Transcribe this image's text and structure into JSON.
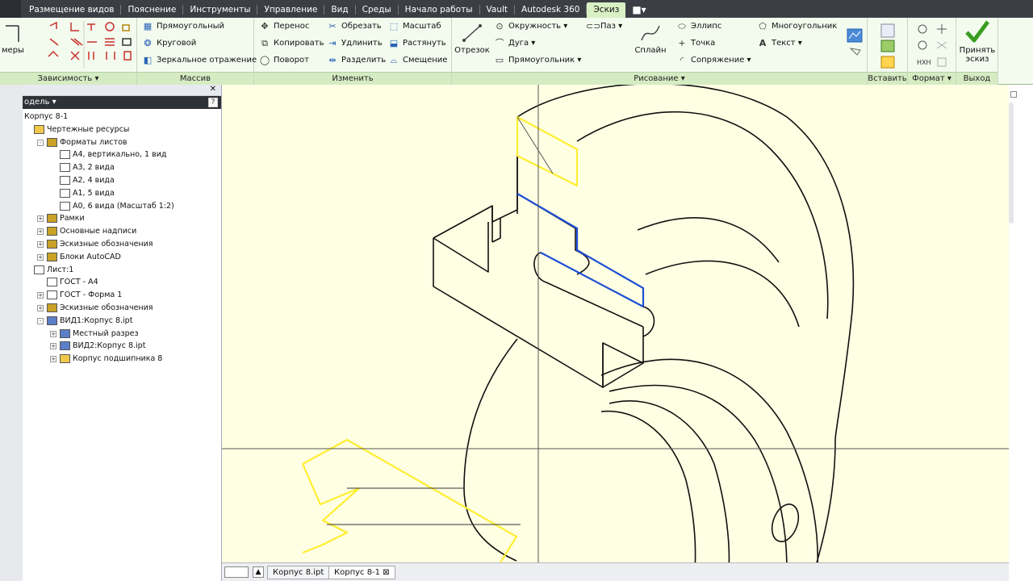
{
  "ribbon_tabs": [
    "Размещение видов",
    "Пояснение",
    "Инструменты",
    "Управление",
    "Вид",
    "Среды",
    "Начало работы",
    "Vault",
    "Autodesk 360",
    "Эскиз"
  ],
  "active_tab": "Эскиз",
  "tab_extra_icon": "video-icon",
  "ribbon": {
    "constraints": {
      "label": "Зависимость",
      "dims_label": "меры"
    },
    "pattern": {
      "label": "Массив",
      "rectangular": "Прямоугольный",
      "circular": "Круговой",
      "mirror": "Зеркальное отражение"
    },
    "modify": {
      "label": "Изменить",
      "move": "Перенос",
      "copy": "Копировать",
      "rotate": "Поворот",
      "trim": "Обрезать",
      "extend": "Удлинить",
      "split": "Разделить",
      "scale": "Масштаб",
      "stretch": "Растянуть",
      "offset": "Смещение"
    },
    "draw": {
      "label": "Рисование",
      "line": "Отрезок",
      "circle": "Окружность",
      "arc": "Дуга",
      "rectangle": "Прямоугольник",
      "slot": "Паз",
      "spline": "Сплайн",
      "ellipse": "Эллипс",
      "point": "Точка",
      "fillet": "Сопряжение",
      "polygon": "Многоугольник",
      "text": "Текст"
    },
    "insert": {
      "label": "Вставить"
    },
    "format": {
      "label": "Формат"
    },
    "exit": {
      "label": "Выход",
      "finish": "Принять эскиз"
    }
  },
  "browser": {
    "title": "одель",
    "help": "?",
    "tree": [
      {
        "label": "Корпус 8-1",
        "level": 0,
        "icon": "none",
        "expand": ""
      },
      {
        "label": "Чертежные ресурсы",
        "level": 0,
        "icon": "folder-icon",
        "expand": ""
      },
      {
        "label": "Форматы листов",
        "level": 1,
        "icon": "sheet-formats-icon",
        "expand": "-"
      },
      {
        "label": "А4, вертикально, 1 вид",
        "level": 2,
        "icon": "sheet-icon",
        "expand": ""
      },
      {
        "label": "А3, 2 вида",
        "level": 2,
        "icon": "sheet-icon",
        "expand": ""
      },
      {
        "label": "А2, 4 вида",
        "level": 2,
        "icon": "sheet-icon",
        "expand": ""
      },
      {
        "label": "А1, 5 вида",
        "level": 2,
        "icon": "sheet-icon",
        "expand": ""
      },
      {
        "label": "А0, 6 вида (Масштаб 1:2)",
        "level": 2,
        "icon": "sheet-icon",
        "expand": ""
      },
      {
        "label": "Рамки",
        "level": 1,
        "icon": "borders-icon",
        "expand": "+"
      },
      {
        "label": "Основные надписи",
        "level": 1,
        "icon": "title-blocks-icon",
        "expand": "+"
      },
      {
        "label": "Эскизные обозначения",
        "level": 1,
        "icon": "sketch-symbols-icon",
        "expand": "+"
      },
      {
        "label": "Блоки AutoCAD",
        "level": 1,
        "icon": "autocad-blocks-icon",
        "expand": "+"
      },
      {
        "label": "Лист:1",
        "level": 0,
        "icon": "sheet-icon",
        "expand": ""
      },
      {
        "label": "ГОСТ - А4",
        "level": 1,
        "icon": "border-icon",
        "expand": ""
      },
      {
        "label": "ГОСТ - Форма 1",
        "level": 1,
        "icon": "title-block-icon",
        "expand": "+"
      },
      {
        "label": "Эскизные обозначения",
        "level": 1,
        "icon": "sketch-symbols-icon",
        "expand": "+"
      },
      {
        "label": "ВИД1:Корпус 8.ipt",
        "level": 1,
        "icon": "view-icon",
        "expand": "-"
      },
      {
        "label": "Местный разрез",
        "level": 2,
        "icon": "section-icon",
        "expand": "+"
      },
      {
        "label": "ВИД2:Корпус 8.ipt",
        "level": 2,
        "icon": "view-icon",
        "expand": "+"
      },
      {
        "label": "Корпус подшипника 8",
        "level": 2,
        "icon": "part-icon",
        "expand": "+"
      }
    ]
  },
  "document_tabs": [
    {
      "label": "Корпус 8.ipt",
      "active": false
    },
    {
      "label": "Корпус 8-1",
      "active": true
    }
  ],
  "colors": {
    "canvas_bg": "#ffffe3",
    "highlight_yellow": "#ffee33",
    "highlight_blue": "#1f4fd6",
    "ribbon_bg": "#f3fbef",
    "tab_active": "#d9f0c4"
  }
}
